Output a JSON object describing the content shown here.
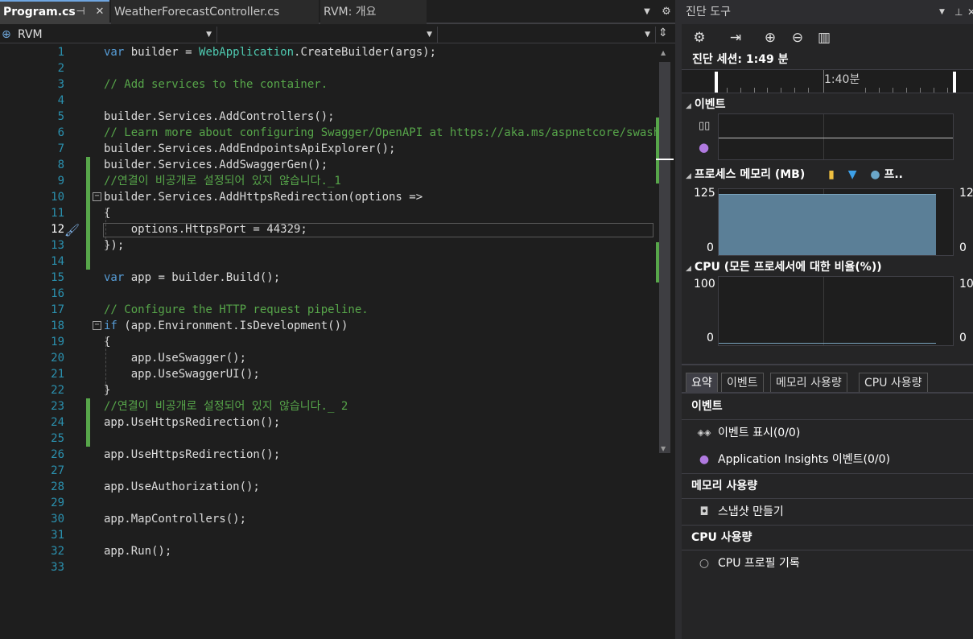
{
  "tabs": [
    {
      "label": "Program.cs",
      "active": true
    },
    {
      "label": "WeatherForecastController.cs",
      "active": false
    },
    {
      "label": "RVM: 개요",
      "active": false
    }
  ],
  "navbar": {
    "project": "RVM",
    "type": "",
    "member": ""
  },
  "code": {
    "current_line": 12,
    "lines": [
      {
        "n": "1",
        "text": "var builder = WebApplication.CreateBuilder(args);"
      },
      {
        "n": "2",
        "text": ""
      },
      {
        "n": "3",
        "text": "// Add services to the container."
      },
      {
        "n": "4",
        "text": ""
      },
      {
        "n": "5",
        "text": "builder.Services.AddControllers();"
      },
      {
        "n": "6",
        "text": "// Learn more about configuring Swagger/OpenAPI at https://aka.ms/aspnetcore/swashbuck"
      },
      {
        "n": "7",
        "text": "builder.Services.AddEndpointsApiExplorer();"
      },
      {
        "n": "8",
        "text": "builder.Services.AddSwaggerGen();"
      },
      {
        "n": "9",
        "text": "//연결이 비공개로 설정되어 있지 않습니다._1"
      },
      {
        "n": "10",
        "text": "builder.Services.AddHttpsRedirection(options =>"
      },
      {
        "n": "11",
        "text": "{"
      },
      {
        "n": "12",
        "text": "    options.HttpsPort = 44329;"
      },
      {
        "n": "13",
        "text": "});"
      },
      {
        "n": "14",
        "text": ""
      },
      {
        "n": "15",
        "text": "var app = builder.Build();"
      },
      {
        "n": "16",
        "text": ""
      },
      {
        "n": "17",
        "text": "// Configure the HTTP request pipeline."
      },
      {
        "n": "18",
        "text": "if (app.Environment.IsDevelopment())"
      },
      {
        "n": "19",
        "text": "{"
      },
      {
        "n": "20",
        "text": "    app.UseSwagger();"
      },
      {
        "n": "21",
        "text": "    app.UseSwaggerUI();"
      },
      {
        "n": "22",
        "text": "}"
      },
      {
        "n": "23",
        "text": "//연결이 비공개로 설정되어 있지 않습니다._ 2"
      },
      {
        "n": "24",
        "text": "app.UseHttpsRedirection();"
      },
      {
        "n": "25",
        "text": ""
      },
      {
        "n": "26",
        "text": "app.UseHttpsRedirection();"
      },
      {
        "n": "27",
        "text": ""
      },
      {
        "n": "28",
        "text": "app.UseAuthorization();"
      },
      {
        "n": "29",
        "text": ""
      },
      {
        "n": "30",
        "text": "app.MapControllers();"
      },
      {
        "n": "31",
        "text": ""
      },
      {
        "n": "32",
        "text": "app.Run();"
      },
      {
        "n": "33",
        "text": ""
      }
    ]
  },
  "diagnostics": {
    "title": "진단 도구",
    "session": "진단 세션: 1:49 분",
    "timeline_label": "1:40분",
    "events_header": "이벤트",
    "memory_header": "프로세스 메모리 (MB)",
    "memory_legend": "프..",
    "memory_ymax": "125",
    "memory_ymin": "0",
    "memory_ymax_right": "12",
    "memory_ymin_right": "0",
    "memory_level": 125,
    "cpu_header": "CPU (모든 프로세서에 대한 비율(%))",
    "cpu_ymax": "100",
    "cpu_ymin": "0",
    "cpu_ymax_right": "10",
    "cpu_ymin_right": "0",
    "tabs": [
      "요약",
      "이벤트",
      "메모리 사용량",
      "CPU 사용량"
    ],
    "summary": {
      "events_title": "이벤트",
      "show_events": "이벤트 표시(0/0)",
      "ai_events": "Application Insights 이벤트(0/0)",
      "memory_title": "메모리 사용량",
      "snapshot": "스냅샷 만들기",
      "cpu_title": "CPU 사용량",
      "cpu_profile": "CPU 프로필 기록"
    }
  },
  "colors": {
    "keyword": "#569cd6",
    "type": "#4ec9b0",
    "comment": "#57a64a",
    "change_marker": "#57a64a",
    "memory_fill": "#5b7f97"
  }
}
